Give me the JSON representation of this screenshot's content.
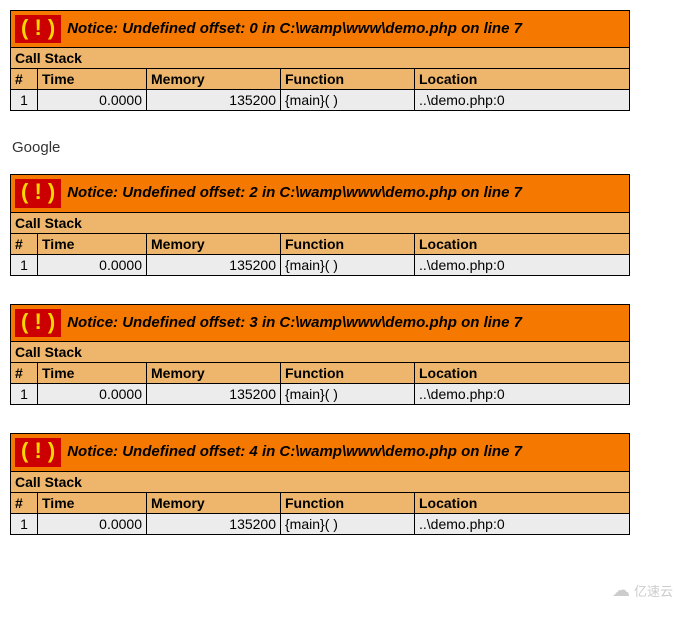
{
  "errors": [
    {
      "message": "Notice: Undefined offset: 0 in C:\\wamp\\www\\demo.php on line ",
      "line": "7",
      "callstack_label": "Call Stack",
      "headers": {
        "num": "#",
        "time": "Time",
        "memory": "Memory",
        "function": "Function",
        "location": "Location"
      },
      "row": {
        "num": "1",
        "time": "0.0000",
        "memory": "135200",
        "function": "{main}( )",
        "location": "..\\demo.php:0"
      }
    },
    {
      "message": "Notice: Undefined offset: 2 in C:\\wamp\\www\\demo.php on line ",
      "line": "7",
      "callstack_label": "Call Stack",
      "headers": {
        "num": "#",
        "time": "Time",
        "memory": "Memory",
        "function": "Function",
        "location": "Location"
      },
      "row": {
        "num": "1",
        "time": "0.0000",
        "memory": "135200",
        "function": "{main}( )",
        "location": "..\\demo.php:0"
      }
    },
    {
      "message": "Notice: Undefined offset: 3 in C:\\wamp\\www\\demo.php on line ",
      "line": "7",
      "callstack_label": "Call Stack",
      "headers": {
        "num": "#",
        "time": "Time",
        "memory": "Memory",
        "function": "Function",
        "location": "Location"
      },
      "row": {
        "num": "1",
        "time": "0.0000",
        "memory": "135200",
        "function": "{main}( )",
        "location": "..\\demo.php:0"
      }
    },
    {
      "message": "Notice: Undefined offset: 4 in C:\\wamp\\www\\demo.php on line ",
      "line": "7",
      "callstack_label": "Call Stack",
      "headers": {
        "num": "#",
        "time": "Time",
        "memory": "Memory",
        "function": "Function",
        "location": "Location"
      },
      "row": {
        "num": "1",
        "time": "0.0000",
        "memory": "135200",
        "function": "{main}( )",
        "location": "..\\demo.php:0"
      }
    }
  ],
  "between_text": "Google",
  "icon_glyph": "( ! )",
  "watermark": "亿速云"
}
